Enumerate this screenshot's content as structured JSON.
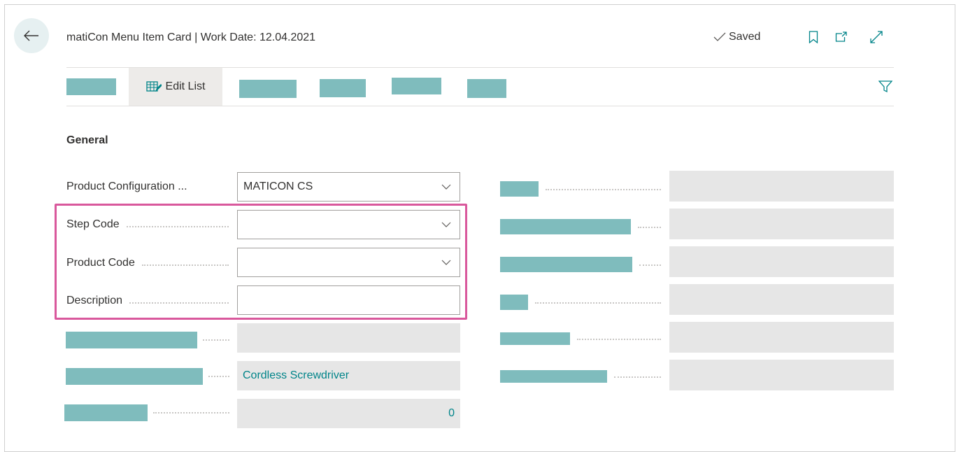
{
  "header": {
    "title": "matiCon Menu Item Card | Work Date: 12.04.2021",
    "saved_label": "Saved"
  },
  "toolbar": {
    "edit_list_label": "Edit List"
  },
  "general": {
    "section_title": "General",
    "product_configuration": {
      "label": "Product Configuration ...",
      "value": "MATICON CS"
    },
    "step_code": {
      "label": "Step Code",
      "value": ""
    },
    "product_code": {
      "label": "Product Code",
      "value": ""
    },
    "description": {
      "label": "Description",
      "value": ""
    },
    "item_description_value": "Cordless Screwdriver",
    "quantity_value": "0"
  },
  "colors": {
    "accent": "#008489",
    "redacted_block": "#7fbcbd",
    "highlight_border": "#d9589c",
    "readonly_field": "#e6e6e6"
  },
  "icons": {
    "back": "back-arrow-icon",
    "saved": "checkmark-icon",
    "bookmark": "bookmark-icon",
    "open_new": "open-in-new-window-icon",
    "expand": "expand-icon",
    "edit_list": "edit-list-icon",
    "filter": "filter-icon",
    "dropdown": "chevron-down-icon"
  }
}
